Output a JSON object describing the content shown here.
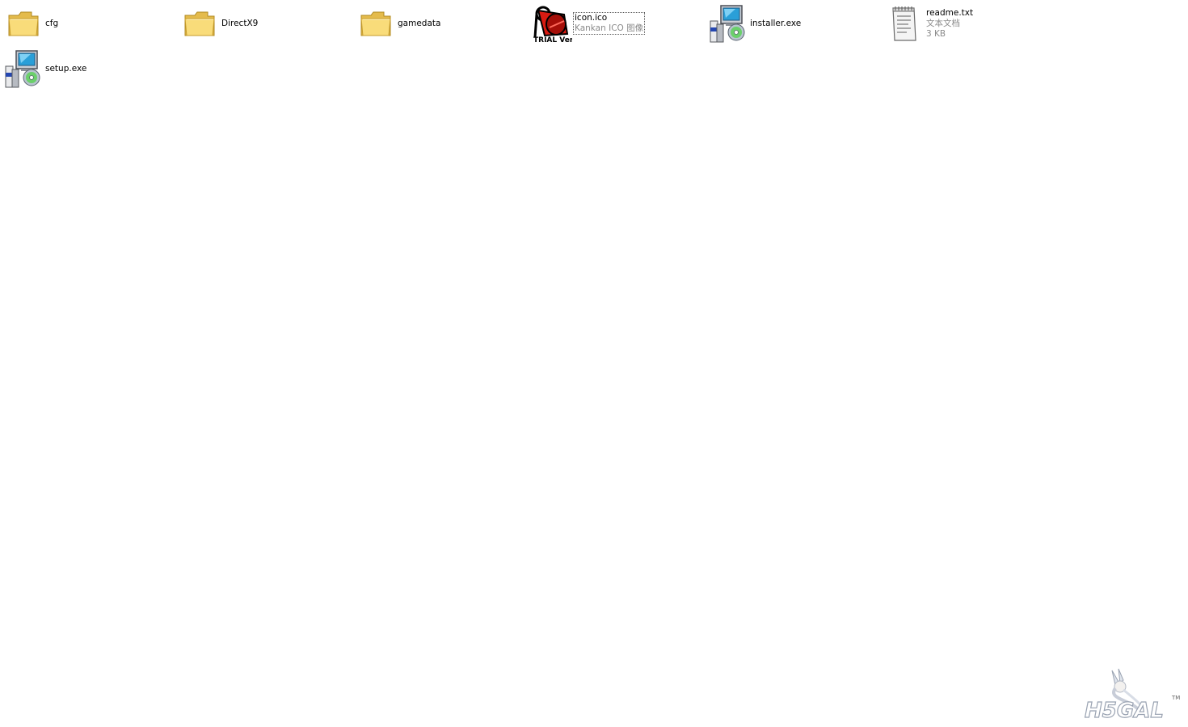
{
  "window": {
    "view": "Tiles"
  },
  "items": [
    {
      "name": "cfg",
      "type": "folder",
      "icon": "folder-icon"
    },
    {
      "name": "DirectX9",
      "type": "folder",
      "icon": "folder-icon"
    },
    {
      "name": "gamedata",
      "type": "folder",
      "icon": "folder-icon"
    },
    {
      "name": "icon.ico",
      "type_label": "Kankan ICO 图像",
      "icon": "trial-ver-icon",
      "selected": true,
      "icon_caption": "TRIAL Ver"
    },
    {
      "name": "installer.exe",
      "type": "application",
      "icon": "installer-icon"
    },
    {
      "name": "readme.txt",
      "type_label": "文本文档",
      "size": "3 KB",
      "icon": "text-document-icon"
    },
    {
      "name": "setup.exe",
      "type": "application",
      "icon": "installer-icon"
    }
  ],
  "watermark": {
    "text": "H5GAL",
    "tm": "TM",
    "icon": "h5gal-logo-icon"
  },
  "colors": {
    "folder": "#f5d36a",
    "folder_shade": "#e0b548",
    "selection_outline": "#555555",
    "secondary_text": "#8a8a8a"
  }
}
